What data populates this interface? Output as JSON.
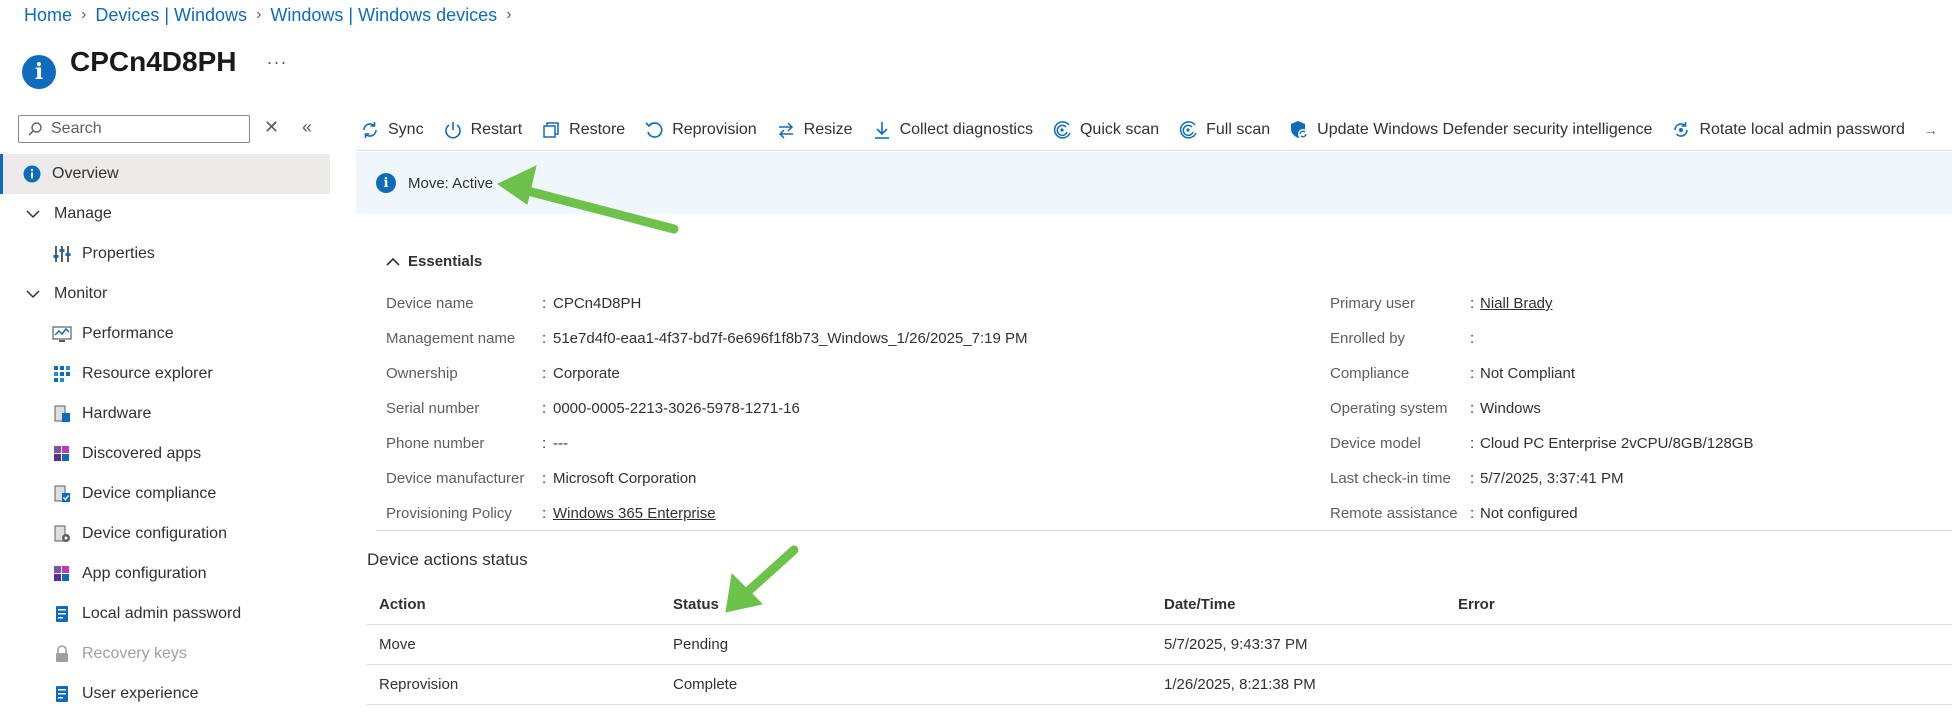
{
  "breadcrumb": [
    "Home",
    "Devices | Windows",
    "Windows | Windows devices"
  ],
  "title": "CPCn4D8PH",
  "title_more": "···",
  "search": {
    "placeholder": "Search"
  },
  "nav": {
    "overview": "Overview",
    "manage": "Manage",
    "properties": "Properties",
    "monitor": "Monitor",
    "performance": "Performance",
    "resource_explorer": "Resource explorer",
    "hardware": "Hardware",
    "discovered_apps": "Discovered apps",
    "device_compliance": "Device compliance",
    "device_configuration": "Device configuration",
    "app_configuration": "App configuration",
    "local_admin_password": "Local admin password",
    "recovery_keys": "Recovery keys",
    "user_experience": "User experience"
  },
  "toolbar": {
    "sync": "Sync",
    "restart": "Restart",
    "restore": "Restore",
    "reprovision": "Reprovision",
    "resize": "Resize",
    "collect_diagnostics": "Collect diagnostics",
    "quick_scan": "Quick scan",
    "full_scan": "Full scan",
    "update_defender": "Update Windows Defender security intelligence",
    "rotate_password": "Rotate local admin password"
  },
  "banner": {
    "text": "Move: Active"
  },
  "essentials": {
    "header": "Essentials",
    "left": [
      {
        "key": "Device name",
        "value": "CPCn4D8PH"
      },
      {
        "key": "Management name",
        "value": "51e7d4f0-eaa1-4f37-bd7f-6e696f1f8b73_Windows_1/26/2025_7:19 PM"
      },
      {
        "key": "Ownership",
        "value": "Corporate"
      },
      {
        "key": "Serial number",
        "value": "0000-0005-2213-3026-5978-1271-16"
      },
      {
        "key": "Phone number",
        "value": "---"
      },
      {
        "key": "Device manufacturer",
        "value": "Microsoft Corporation"
      },
      {
        "key": "Provisioning Policy",
        "value": "Windows 365 Enterprise"
      }
    ],
    "right": [
      {
        "key": "Primary user",
        "value": "Niall Brady"
      },
      {
        "key": "Enrolled by",
        "value": ""
      },
      {
        "key": "Compliance",
        "value": "Not Compliant"
      },
      {
        "key": "Operating system",
        "value": "Windows"
      },
      {
        "key": "Device model",
        "value": "Cloud PC Enterprise 2vCPU/8GB/128GB"
      },
      {
        "key": "Last check-in time",
        "value": "5/7/2025, 3:37:41 PM"
      },
      {
        "key": "Remote assistance",
        "value": "Not configured"
      }
    ],
    "colon": ":"
  },
  "actions_status": {
    "title": "Device actions status",
    "columns": [
      "Action",
      "Status",
      "Date/Time",
      "Error"
    ],
    "rows": [
      [
        "Move",
        "Pending",
        "5/7/2025, 9:43:37 PM",
        ""
      ],
      [
        "Reprovision",
        "Complete",
        "1/26/2025, 8:21:38 PM",
        ""
      ]
    ]
  },
  "colors": {
    "accent": "#0f6cbd",
    "annotation": "#6cc24a"
  }
}
